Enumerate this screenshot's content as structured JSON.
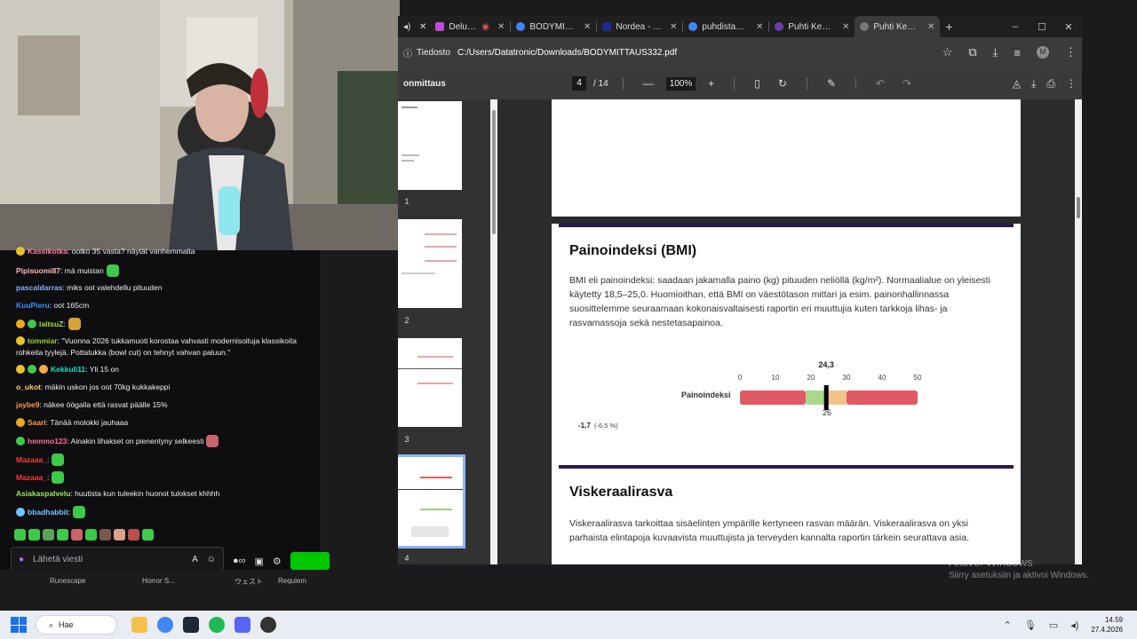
{
  "browser": {
    "tabs": [
      {
        "label": "Delulu Str",
        "color": "#c04bd6"
      },
      {
        "label": "BODYMITTAU",
        "color": "#4285f4"
      },
      {
        "label": "Nordea - Tun",
        "color": "#1e2a8c"
      },
      {
        "label": "puhdistamo",
        "color": "#4285f4"
      },
      {
        "label": "Puhti Kehonm",
        "color": "#6b3fa0"
      },
      {
        "label": "Puhti Kehonm",
        "color": "#777777",
        "active": true
      }
    ],
    "new_tab_icon": "+",
    "window_controls": [
      "–",
      "☐",
      "✕"
    ],
    "site_chip": "Tiedosto",
    "url": "C:/Users/Datatronic/Downloads/BODYMITTAUS332.pdf"
  },
  "pdf": {
    "doc_title": "onmittaus",
    "current_page": "4",
    "total_pages": "/ 14",
    "zoom": "100%",
    "thumbnails": [
      "1",
      "2",
      "3",
      "4"
    ],
    "bmi": {
      "heading": "Painoindeksi (BMI)",
      "text": "BMI eli painoindeksi: saadaan jakamalla paino (kg) pituuden neliöllä (kg/m²). Normaalialue on yleisesti käytetty 18,5–25,0. Huomioithan, että BMI on väestötason mittari ja esim. painonhallinnassa suosittelemme seuraamaan kokonaisvaltaisesti raportin eri muuttujia kuten tarkkoja lihas- ja rasvamassoja sekä nestetasapainoa.",
      "label": "Painoindeksi",
      "scale": [
        "0",
        "10",
        "20",
        "30",
        "40",
        "50"
      ],
      "value_label": "24,3",
      "below_label": "26",
      "delta": "-1,7",
      "delta_pct": "(-6,5 %)"
    },
    "visc": {
      "heading": "Viskeraalirasva",
      "text": "Viskeraalirasva tarkoittaa sisäelinten ympärille kertyneen rasvan määrän. Viskeraalirasva on yksi parhaista elintapoja kuvaavista muuttujista ja terveyden kannalta raportin tärkein seurattava asia."
    }
  },
  "chart_data": {
    "type": "bar",
    "title": "",
    "categories": [
      "Painoindeksi"
    ],
    "xlim": [
      0,
      50
    ],
    "ticks": [
      0,
      10,
      20,
      30,
      40,
      50
    ],
    "value": 24.3,
    "previous": 26,
    "change": -1.7,
    "change_pct": -6.5,
    "zones": [
      {
        "from": 0,
        "to": 18.5,
        "color": "#e05a63"
      },
      {
        "from": 18.5,
        "to": 25,
        "color": "#a9d98a"
      },
      {
        "from": 25,
        "to": 30,
        "color": "#f2c28a"
      },
      {
        "from": 30,
        "to": 50,
        "color": "#e05a63"
      }
    ]
  },
  "chat": {
    "messages": [
      {
        "user": "Kassikotka",
        "color": "#ff7f9e",
        "text": ": ootko 35 vasta? näytät vanhemmalta"
      },
      {
        "user": "Pipisuomi87",
        "color": "#ffb6c1",
        "text": ": mä muistan"
      },
      {
        "user": "pascaldarras",
        "color": "#8ab4ff",
        "text": ": miks oot valehdellu pituuden"
      },
      {
        "user": "KuuPieru",
        "color": "#3a8dff",
        "text": ": oot 165cm"
      },
      {
        "user": "laitsuZ",
        "color": "#a6e22e",
        "text": ":"
      },
      {
        "user": "tommiar",
        "color": "#9acd32",
        "text": ": ''Vuonna 2026 tukkamuoti korostaa vahvasti modernisoituja klassikoita"
      },
      {
        "user": "",
        "color": "#efeff1",
        "text": "rohkeita tyylejä. Pottatukka (bowl cut) on tehnyt vahvan paluun.''"
      },
      {
        "user": "Kekkuli11",
        "color": "#00e6c3",
        "text": ": Yli 15 on"
      },
      {
        "user": "o_ukot",
        "color": "#ffd27f",
        "text": ": mäkin uskon jos oot 70kg kukkakeppi"
      },
      {
        "user": "jaybe9",
        "color": "#ff9c3a",
        "text": ": näkee öögalla että rasvat päälle 15%"
      },
      {
        "user": "Saari",
        "color": "#ff9c3a",
        "text": ": Tänää molokki jauhaaa"
      },
      {
        "user": "hemmo123",
        "color": "#ff6b9d",
        "text": ": Ainakin lihakset on pienentyny selkeesti"
      },
      {
        "user": "Mazaaa_",
        "color": "#ff3c3c",
        "text": ":"
      },
      {
        "user": "Mazaaa_",
        "color": "#ff3c3c",
        "text": ":"
      },
      {
        "user": "Asiakaspalvelu",
        "color": "#9be564",
        "text": ": huutista kun tuleekin huonot tulokset khhhh"
      },
      {
        "user": "bbadhabbit",
        "color": "#6fc7ff",
        "text": ":"
      }
    ],
    "input_placeholder": "Lähetä viesti"
  },
  "background_games": [
    "Runescape",
    "Horror S...",
    "ウェスト",
    "Requiem"
  ],
  "watermark": {
    "line1": "Aktivoi Windows",
    "line2": "Siirry asetuksiin ja aktivoi Windows."
  },
  "taskbar": {
    "search_label": "Hae",
    "time": "14.59",
    "date": "27.4.2026"
  }
}
